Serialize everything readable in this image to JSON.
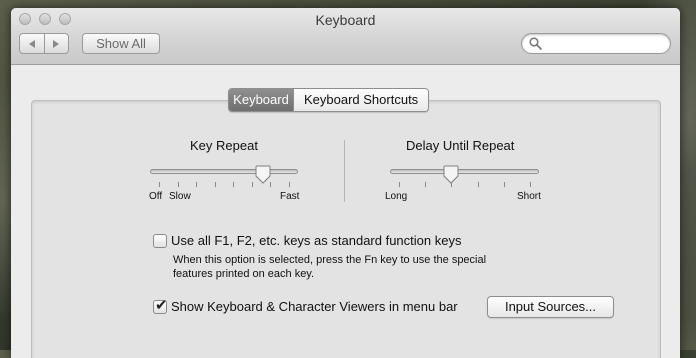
{
  "window": {
    "title": "Keyboard"
  },
  "toolbar": {
    "back_icon": "chevron-left-icon",
    "forward_icon": "chevron-right-icon",
    "show_all_label": "Show All",
    "search": {
      "value": "",
      "placeholder": "",
      "icon": "search-icon"
    }
  },
  "tabs": [
    {
      "label": "Keyboard",
      "active": true
    },
    {
      "label": "Keyboard Shortcuts",
      "active": false
    }
  ],
  "key_repeat": {
    "title": "Key Repeat",
    "labels": {
      "off": "Off",
      "slow": "Slow",
      "fast": "Fast"
    },
    "value_fraction": 0.8,
    "tick_count": 8
  },
  "delay_until_repeat": {
    "title": "Delay Until Repeat",
    "labels": {
      "long": "Long",
      "short": "Short"
    },
    "value_fraction": 0.4,
    "tick_count": 6
  },
  "options": {
    "function_keys": {
      "label": "Use all F1, F2, etc. keys as standard function keys",
      "checked": false,
      "description_line1": "When this option is selected, press the Fn key to use the special",
      "description_line2": "features printed on each key."
    },
    "show_viewers": {
      "label": "Show Keyboard & Character Viewers in menu bar",
      "checked": true,
      "check_glyph": "✔"
    }
  },
  "input_sources_button": {
    "label": "Input Sources..."
  }
}
